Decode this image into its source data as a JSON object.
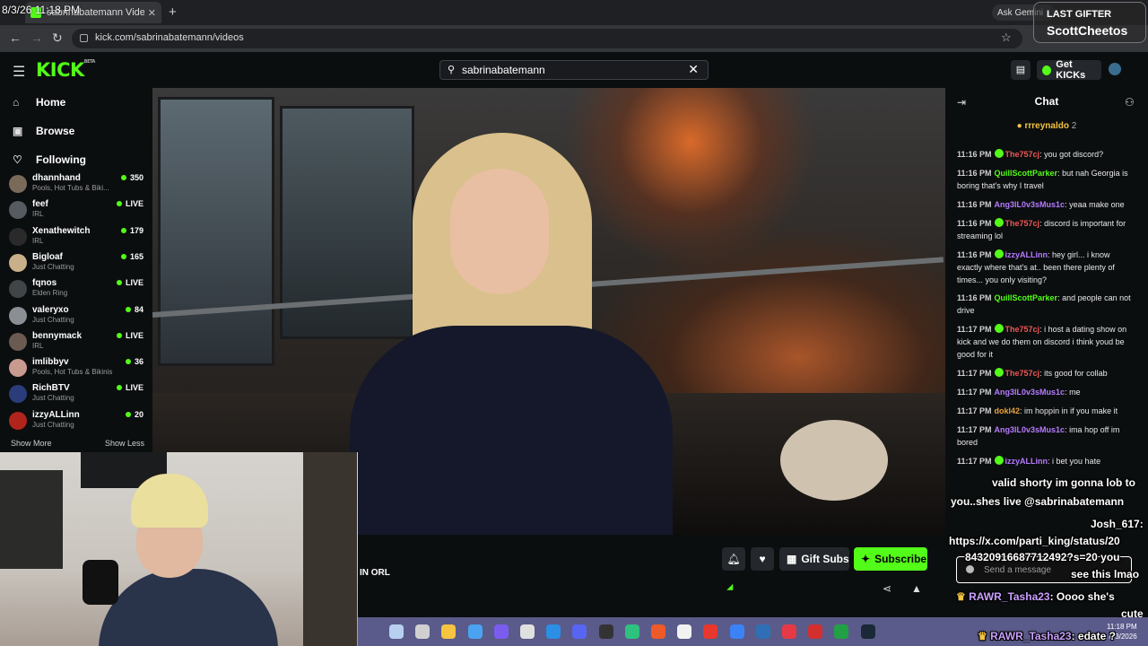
{
  "overlay_datetime": "8/3/26 11:18 PM",
  "browser": {
    "tab_title": "sabrinabatemann Videos - Kick",
    "url": "kick.com/sabrinabatemann/videos",
    "ask_label": "Ask Gemini"
  },
  "header": {
    "logo": "KICK",
    "logo_tag": "BETA",
    "search_value": "sabrinabatemann",
    "get_kicks_label": "Get KICKs"
  },
  "sidebar": {
    "nav": [
      {
        "label": "Home",
        "icon": "home-icon"
      },
      {
        "label": "Browse",
        "icon": "browse-icon"
      },
      {
        "label": "Following",
        "icon": "heart-icon"
      }
    ],
    "channels": [
      {
        "name": "dhannhand",
        "category": "Pools, Hot Tubs & Biki...",
        "viewers": "350",
        "color": "#7a6a5a"
      },
      {
        "name": "feef",
        "category": "IRL",
        "viewers": "LIVE",
        "color": "#555b60"
      },
      {
        "name": "Xenathewitch",
        "category": "IRL",
        "viewers": "179",
        "color": "#2a2a2a"
      },
      {
        "name": "Bigloaf",
        "category": "Just Chatting",
        "viewers": "165",
        "color": "#c9b08a"
      },
      {
        "name": "fqnos",
        "category": "Elden Ring",
        "viewers": "LIVE",
        "color": "#404648"
      },
      {
        "name": "valeryxo",
        "category": "Just Chatting",
        "viewers": "84",
        "color": "#8a8f94"
      },
      {
        "name": "bennymack",
        "category": "IRL",
        "viewers": "LIVE",
        "color": "#6a5a52"
      },
      {
        "name": "imlibbyv",
        "category": "Pools, Hot Tubs & Bikinis",
        "viewers": "36",
        "color": "#c89a90"
      },
      {
        "name": "RichBTV",
        "category": "Just Chatting",
        "viewers": "LIVE",
        "color": "#2a3c7a"
      },
      {
        "name": "izzyALLinn",
        "category": "Just Chatting",
        "viewers": "20",
        "color": "#b0241c"
      }
    ],
    "show_more": "Show More",
    "show_less": "Show Less"
  },
  "stream": {
    "title_fragment": "IN ORL",
    "gift_label": "Gift Subs",
    "subscribe_label": "Subscribe"
  },
  "chat": {
    "title": "Chat",
    "pinned_user": "rrreynaldo",
    "pinned_count": "2",
    "placeholder": "Send a message",
    "messages": [
      {
        "time": "11:16 PM",
        "user": "The757cj",
        "color": "#f25555",
        "badge": true,
        "text": ": you got discord?"
      },
      {
        "time": "11:16 PM",
        "user": "QuillScottParker",
        "color": "#53fc18",
        "badge": false,
        "text": ": but nah Georgia is boring that's why I travel"
      },
      {
        "time": "11:16 PM",
        "user": "Ang3lL0v3sMus1c",
        "color": "#b57aff",
        "badge": false,
        "text": ": yeaa make one"
      },
      {
        "time": "11:16 PM",
        "user": "The757cj",
        "color": "#f25555",
        "badge": true,
        "text": ": discord is important for streaming lol"
      },
      {
        "time": "11:16 PM",
        "user": "izzyALLinn",
        "color": "#b57aff",
        "badge": true,
        "text": ": hey girl... i know exactly where that's at.. been there plenty of times... you only visiting?"
      },
      {
        "time": "11:16 PM",
        "user": "QuillScottParker",
        "color": "#53fc18",
        "badge": false,
        "text": ": and people can not drive"
      },
      {
        "time": "11:17 PM",
        "user": "The757cj",
        "color": "#f25555",
        "badge": true,
        "text": ": i host a dating show on kick and we do them on discord i think youd be good for it"
      },
      {
        "time": "11:17 PM",
        "user": "The757cj",
        "color": "#f25555",
        "badge": true,
        "text": ": its good for collab"
      },
      {
        "time": "11:17 PM",
        "user": "Ang3lL0v3sMus1c",
        "color": "#b57aff",
        "badge": false,
        "text": ": me"
      },
      {
        "time": "11:17 PM",
        "user": "dokl42",
        "color": "#e8a23a",
        "badge": false,
        "text": ": im hoppin in if you make it"
      },
      {
        "time": "11:17 PM",
        "user": "Ang3lL0v3sMus1c",
        "color": "#b57aff",
        "badge": false,
        "text": ": ima hop off im bored"
      },
      {
        "time": "11:17 PM",
        "user": "izzyALLinn",
        "color": "#b57aff",
        "badge": true,
        "text": ": i bet you hate"
      }
    ]
  },
  "overlay": {
    "last_gifter_label": "LAST GIFTER",
    "last_gifter_name": "ScottCheetos",
    "tts_lines": [
      "valid shorty im gonna lob to",
      "you..shes live @sabrinabatemann",
      "Josh_617:",
      "https://x.com/parti_king/status/20",
      "84320916687712492?s=20 you",
      "see this lmao"
    ],
    "rawr_1_user": "RAWR_Tasha23",
    "rawr_1_text": ": Oooo she's",
    "rawr_1_text2": "cute",
    "rawr_2_user": "RAWR_Tasha23",
    "rawr_2_text": ": edate ?"
  },
  "taskbar": {
    "time": "11:18 PM",
    "date": "8/3/2026"
  }
}
